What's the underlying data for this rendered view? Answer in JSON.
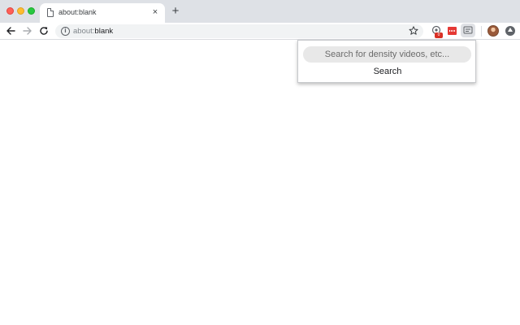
{
  "tab": {
    "title": "about:blank",
    "close_glyph": "×",
    "favicon": "page-icon"
  },
  "new_tab": {
    "glyph": "+"
  },
  "window_controls": {
    "close_color": "#ff5f57",
    "minimize_color": "#febc2e",
    "maximize_color": "#28c840"
  },
  "toolbar": {
    "url_scheme": "about:",
    "url_path": "blank",
    "info_glyph": "i",
    "icons": [
      "back-arrow-icon",
      "forward-arrow-icon",
      "reload-icon",
      "info-icon",
      "star-icon"
    ]
  },
  "extensions": {
    "badge_text": "0",
    "icons": [
      "extension-badge-icon",
      "red-extension-icon",
      "density-extension-icon",
      "profile-avatar",
      "update-icon"
    ]
  },
  "popup": {
    "search_placeholder": "Search for density videos, etc...",
    "search_value": "",
    "search_button_label": "Search"
  }
}
